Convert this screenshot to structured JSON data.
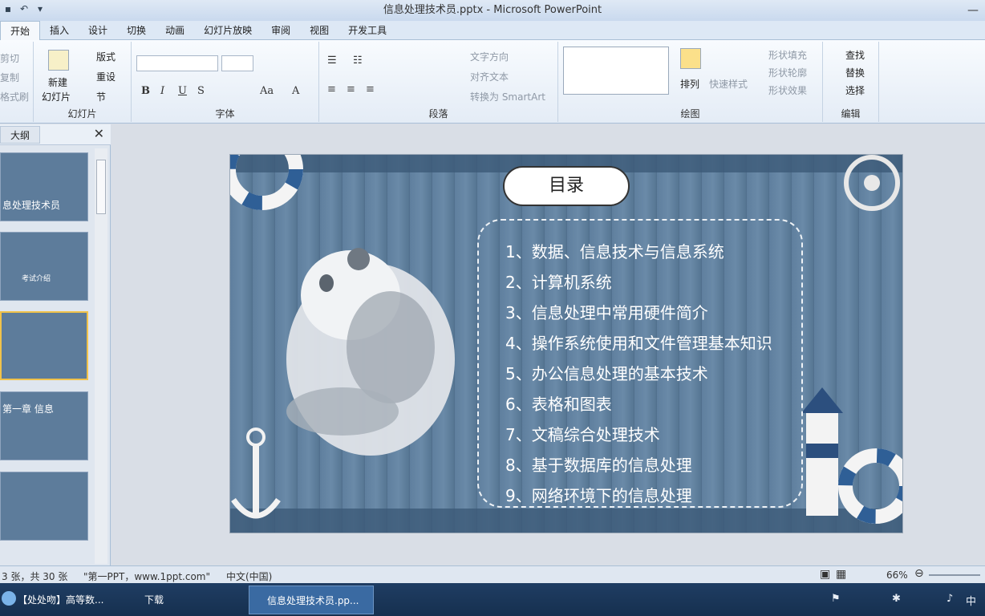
{
  "window": {
    "title": "信息处理技术员.pptx - Microsoft PowerPoint"
  },
  "tabs": [
    "开始",
    "插入",
    "设计",
    "切换",
    "动画",
    "幻灯片放映",
    "审阅",
    "视图",
    "开发工具"
  ],
  "ribbon": {
    "clipboard": {
      "cut": "剪切",
      "copy": "复制",
      "format_painter": "格式刷"
    },
    "slides": {
      "new_slide": "新建",
      "new_slide2": "幻灯片",
      "layout": "版式",
      "reset": "重设",
      "section": "节",
      "label": "幻灯片"
    },
    "font": {
      "label": "字体"
    },
    "paragraph": {
      "text_direction": "文字方向",
      "align_text": "对齐文本",
      "convert_smartart": "转换为 SmartArt",
      "label": "段落"
    },
    "drawing": {
      "arrange": "排列",
      "quick_styles": "快速样式",
      "shape_fill": "形状填充",
      "shape_outline": "形状轮廓",
      "shape_effects": "形状效果",
      "label": "绘图"
    },
    "editing": {
      "find": "查找",
      "replace": "替换",
      "select": "选择",
      "label": "编辑"
    }
  },
  "left_panel": {
    "outline_tab": "大纲",
    "thumbs": [
      {
        "text": "息处理技术员"
      },
      {
        "text": "考试介绍"
      },
      {
        "text": ""
      },
      {
        "text": "第一章 信息"
      },
      {
        "text": ""
      }
    ]
  },
  "slide": {
    "title": "目录",
    "items": [
      "1、数据、信息技术与信息系统",
      "2、计算机系统",
      "3、信息处理中常用硬件简介",
      "4、操作系统使用和文件管理基本知识",
      "5、办公信息处理的基本技术",
      "6、表格和图表",
      "7、文稿综合处理技术",
      "8、基于数据库的信息处理",
      "9、网络环境下的信息处理"
    ]
  },
  "status": {
    "slide_count": "3 张，共 30 张",
    "theme": "\"第一PPT，www.1ppt.com\"",
    "language": "中文(中国)",
    "zoom": "66%"
  },
  "taskbar": {
    "item1": "【处处吻】高等数...",
    "item2": "下载",
    "item3": "信息处理技术员.pp...",
    "ime": "中"
  }
}
